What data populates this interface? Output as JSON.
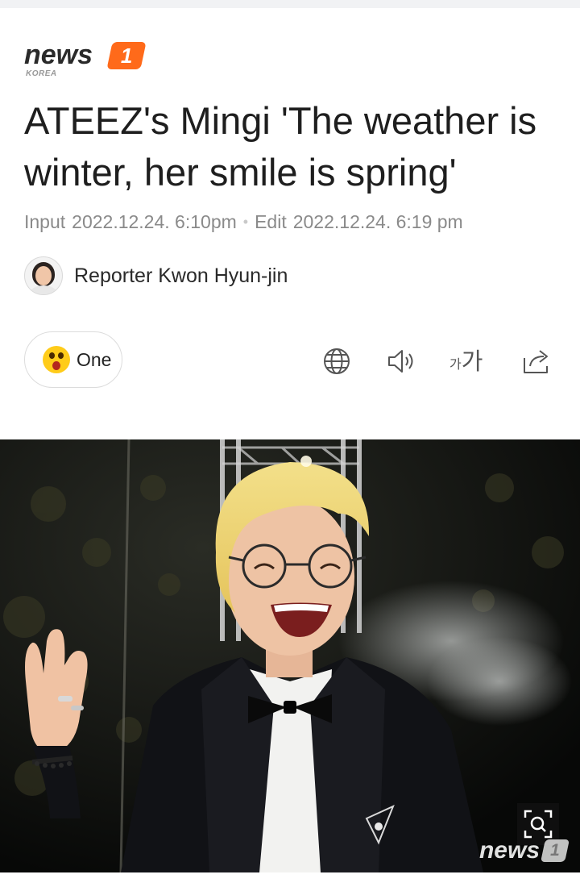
{
  "brand": {
    "logo_word": "news",
    "logo_number": "1",
    "logo_sub": "KOREA"
  },
  "article": {
    "title": "ATEEZ's Mingi 'The weather is winter, her smile is spring'",
    "input_label": "Input",
    "input_time": "2022.12.24. 6:10pm",
    "separator": "•",
    "edit_label": "Edit",
    "edit_time": "2022.12.24. 6:19 pm",
    "reporter": "Reporter Kwon Hyun-jin"
  },
  "toolbar": {
    "reaction_label": "One",
    "reaction_icon": "surprised-emoji-icon",
    "translate_icon": "globe-icon",
    "listen_icon": "speaker-icon",
    "font_small": "가",
    "font_big": "가",
    "share_icon": "share-icon"
  },
  "photo": {
    "zoom_icon": "zoom-icon",
    "watermark_word": "news",
    "watermark_number": "1"
  },
  "colors": {
    "brand_orange": "#ff6a1a",
    "meta_gray": "#8a8a8a",
    "emoji_yellow": "#ffcc1a"
  }
}
